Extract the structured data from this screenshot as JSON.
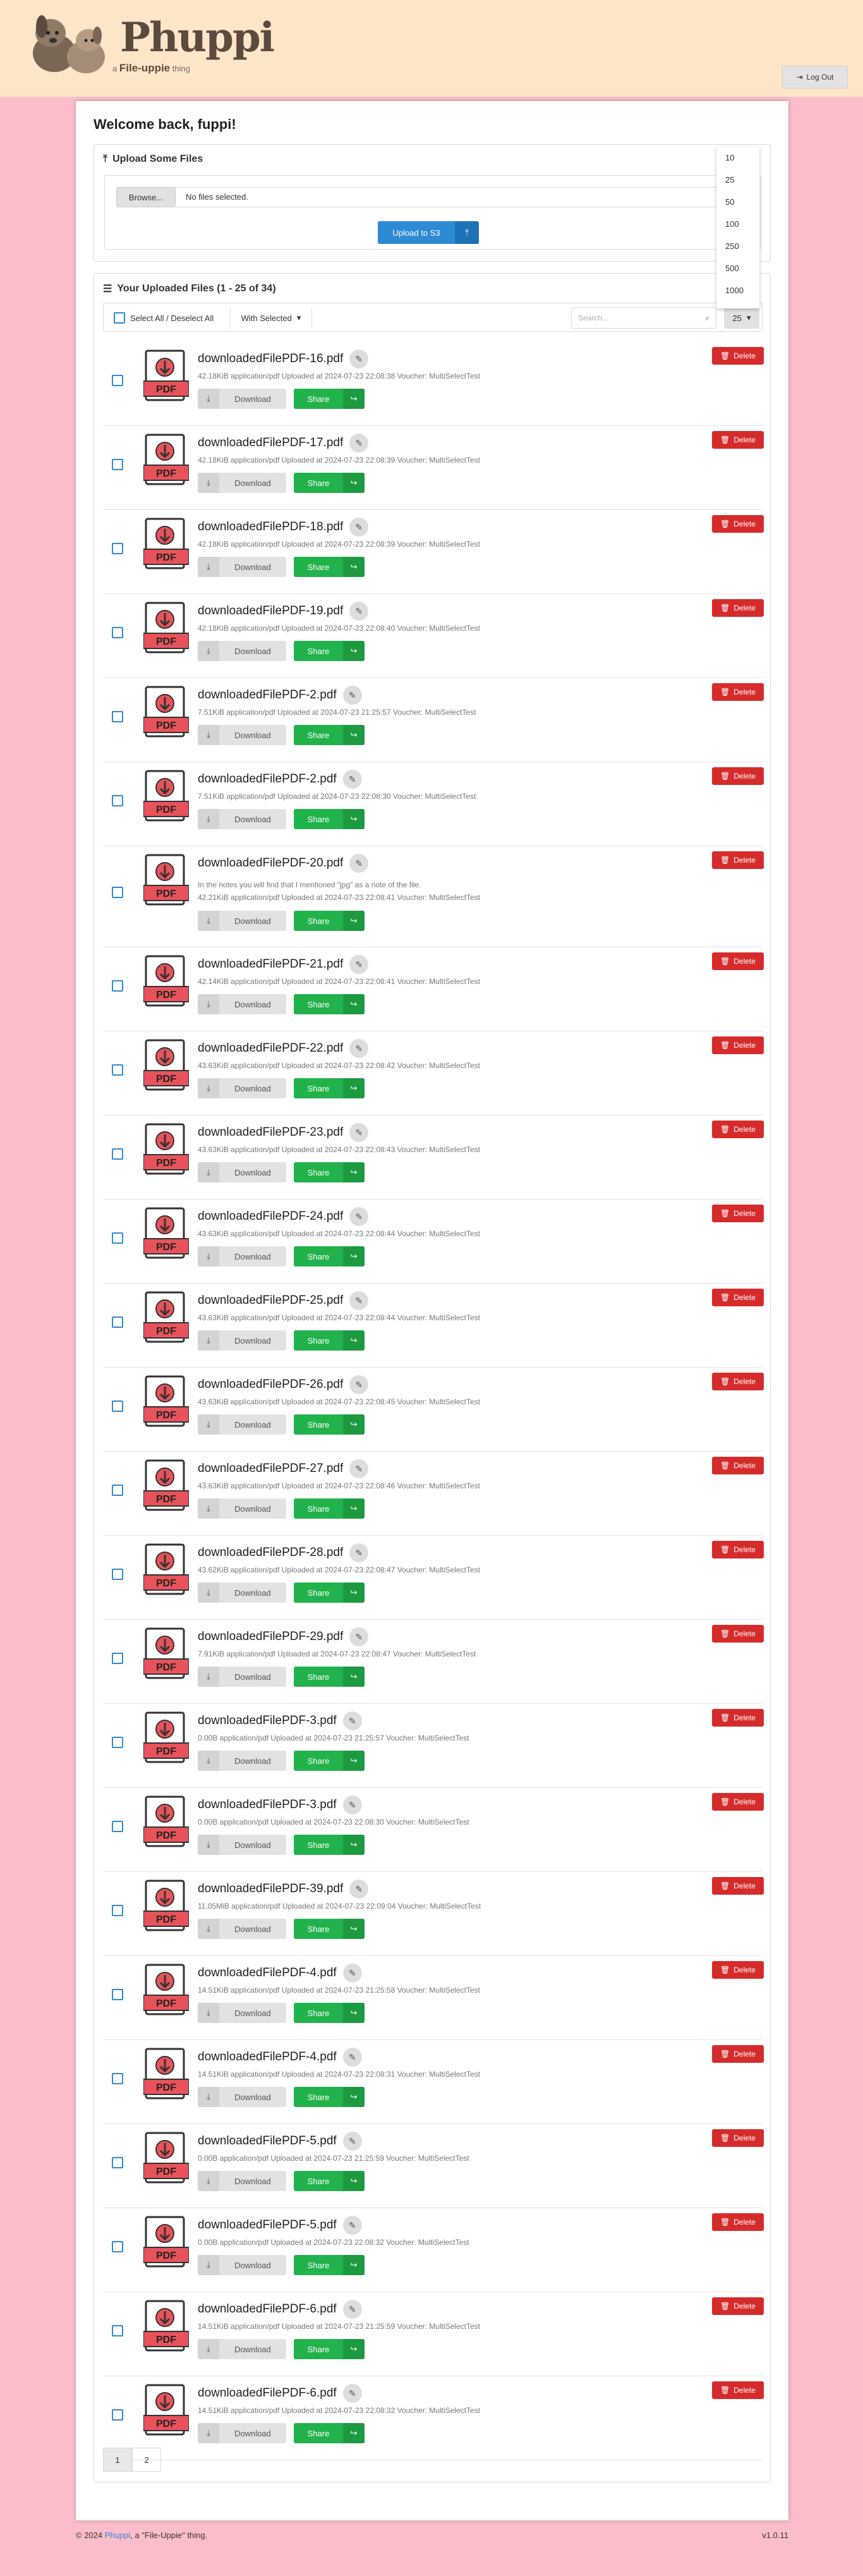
{
  "header": {
    "brand": "Phuppi",
    "tagline_prefix": "a",
    "tagline_name": "File-uppie",
    "tagline_suffix": "thing",
    "logout_label": "Log Out"
  },
  "welcome": "Welcome back, fuppi!",
  "upload": {
    "title": "Upload Some Files",
    "browse_label": "Browse...",
    "no_file_text": "No files selected.",
    "upload_label": "Upload to S3"
  },
  "files": {
    "title": "Your Uploaded Files (1 - 25 of 34)",
    "select_all_label": "Select All / Deselect All",
    "with_selected_label": "With Selected",
    "search_placeholder": "Search...",
    "per_page_value": "25",
    "per_page_options": [
      "10",
      "25",
      "50",
      "100",
      "250",
      "500",
      "1000"
    ],
    "download_label": "Download",
    "share_label": "Share",
    "delete_label": "Delete",
    "items": [
      {
        "name": "downloadedFilePDF-16.pdf",
        "meta": "42.18KiB application/pdf  Uploaded at 2024-07-23 22:08:38  Voucher: MultiSelectTest"
      },
      {
        "name": "downloadedFilePDF-17.pdf",
        "meta": "42.18KiB application/pdf  Uploaded at 2024-07-23 22:08:39  Voucher: MultiSelectTest"
      },
      {
        "name": "downloadedFilePDF-18.pdf",
        "meta": "42.18KiB application/pdf  Uploaded at 2024-07-23 22:08:39  Voucher: MultiSelectTest"
      },
      {
        "name": "downloadedFilePDF-19.pdf",
        "meta": "42.18KiB application/pdf  Uploaded at 2024-07-23 22:08:40  Voucher: MultiSelectTest"
      },
      {
        "name": "downloadedFilePDF-2.pdf",
        "meta": "7.51KiB application/pdf  Uploaded at 2024-07-23 21:25:57  Voucher: MultiSelectTest"
      },
      {
        "name": "downloadedFilePDF-2.pdf",
        "meta": "7.51KiB application/pdf  Uploaded at 2024-07-23 22:08:30  Voucher: MultiSelectTest"
      },
      {
        "name": "downloadedFilePDF-20.pdf",
        "note": "In the notes you will find that I mentioned \"jpg\" as a note of the file.",
        "meta": "42.21KiB application/pdf  Uploaded at 2024-07-23 22:08:41  Voucher: MultiSelectTest"
      },
      {
        "name": "downloadedFilePDF-21.pdf",
        "meta": "42.14KiB application/pdf  Uploaded at 2024-07-23 22:08:41  Voucher: MultiSelectTest"
      },
      {
        "name": "downloadedFilePDF-22.pdf",
        "meta": "43.63KiB application/pdf  Uploaded at 2024-07-23 22:08:42  Voucher: MultiSelectTest"
      },
      {
        "name": "downloadedFilePDF-23.pdf",
        "meta": "43.63KiB application/pdf  Uploaded at 2024-07-23 22:08:43  Voucher: MultiSelectTest"
      },
      {
        "name": "downloadedFilePDF-24.pdf",
        "meta": "43.63KiB application/pdf  Uploaded at 2024-07-23 22:08:44  Voucher: MultiSelectTest"
      },
      {
        "name": "downloadedFilePDF-25.pdf",
        "meta": "43.63KiB application/pdf  Uploaded at 2024-07-23 22:08:44  Voucher: MultiSelectTest"
      },
      {
        "name": "downloadedFilePDF-26.pdf",
        "meta": "43.63KiB application/pdf  Uploaded at 2024-07-23 22:08:45  Voucher: MultiSelectTest"
      },
      {
        "name": "downloadedFilePDF-27.pdf",
        "meta": "43.63KiB application/pdf  Uploaded at 2024-07-23 22:08:46  Voucher: MultiSelectTest"
      },
      {
        "name": "downloadedFilePDF-28.pdf",
        "meta": "43.62KiB application/pdf  Uploaded at 2024-07-23 22:08:47  Voucher: MultiSelectTest"
      },
      {
        "name": "downloadedFilePDF-29.pdf",
        "meta": "7.91KiB application/pdf  Uploaded at 2024-07-23 22:08:47  Voucher: MultiSelectTest"
      },
      {
        "name": "downloadedFilePDF-3.pdf",
        "meta": "0.00B application/pdf  Uploaded at 2024-07-23 21:25:57  Voucher: MultiSelectTest"
      },
      {
        "name": "downloadedFilePDF-3.pdf",
        "meta": "0.00B application/pdf  Uploaded at 2024-07-23 22:08:30  Voucher: MultiSelectTest"
      },
      {
        "name": "downloadedFilePDF-39.pdf",
        "meta": "11.05MiB application/pdf  Uploaded at 2024-07-23 22:09:04  Voucher: MultiSelectTest"
      },
      {
        "name": "downloadedFilePDF-4.pdf",
        "meta": "14.51KiB application/pdf  Uploaded at 2024-07-23 21:25:58  Voucher: MultiSelectTest"
      },
      {
        "name": "downloadedFilePDF-4.pdf",
        "meta": "14.51KiB application/pdf  Uploaded at 2024-07-23 22:08:31  Voucher: MultiSelectTest"
      },
      {
        "name": "downloadedFilePDF-5.pdf",
        "meta": "0.00B application/pdf  Uploaded at 2024-07-23 21:25:59  Voucher: MultiSelectTest"
      },
      {
        "name": "downloadedFilePDF-5.pdf",
        "meta": "0.00B application/pdf  Uploaded at 2024-07-23 22:08:32  Voucher: MultiSelectTest"
      },
      {
        "name": "downloadedFilePDF-6.pdf",
        "meta": "14.51KiB application/pdf  Uploaded at 2024-07-23 21:25:59  Voucher: MultiSelectTest"
      },
      {
        "name": "downloadedFilePDF-6.pdf",
        "meta": "14.51KiB application/pdf  Uploaded at 2024-07-23 22:08:32  Voucher: MultiSelectTest"
      }
    ]
  },
  "pagination": [
    "1",
    "2"
  ],
  "footer": {
    "copyright_prefix": "© 2024",
    "brand_link": "Phuppi",
    "copyright_suffix": ", a \"File-Uppie\" thing.",
    "version": "v1.0.11"
  },
  "colors": {
    "page_bg": "#fbbdc9",
    "header_bg": "#fde5c7",
    "primary": "#2d8bd6",
    "share": "#22b24c",
    "delete": "#d62b2b"
  }
}
